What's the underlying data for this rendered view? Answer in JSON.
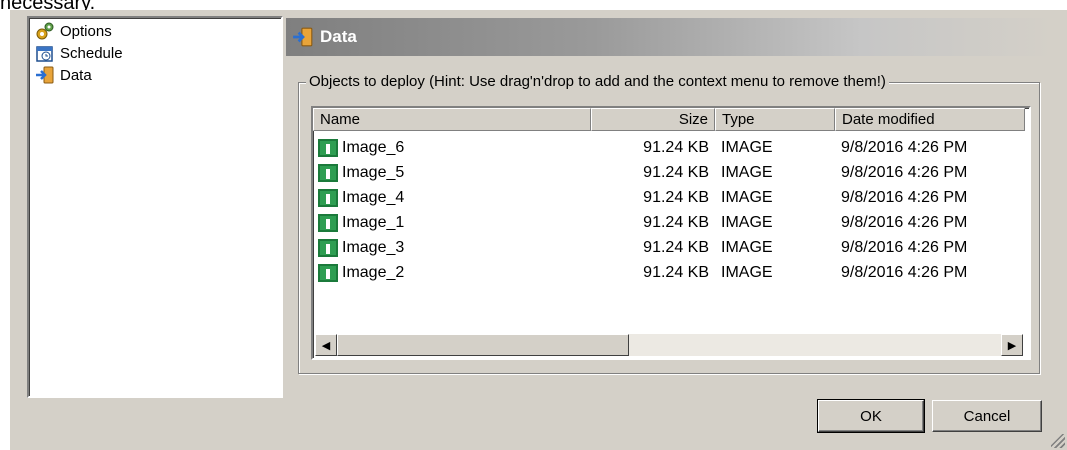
{
  "top_text": "necessary.",
  "tree": {
    "items": [
      {
        "label": "Options",
        "icon": "options-icon"
      },
      {
        "label": "Schedule",
        "icon": "schedule-icon"
      },
      {
        "label": "Data",
        "icon": "data-icon"
      }
    ]
  },
  "header": {
    "title": "Data",
    "icon": "data-icon"
  },
  "group": {
    "legend": "Objects to deploy (Hint: Use drag'n'drop to add and the context menu to remove them!)"
  },
  "list": {
    "columns": [
      "Name",
      "Size",
      "Type",
      "Date modified"
    ],
    "rows": [
      {
        "name": "Image_6",
        "size": "91.24 KB",
        "type": "IMAGE",
        "date": "9/8/2016 4:26 PM"
      },
      {
        "name": "Image_5",
        "size": "91.24 KB",
        "type": "IMAGE",
        "date": "9/8/2016 4:26 PM"
      },
      {
        "name": "Image_4",
        "size": "91.24 KB",
        "type": "IMAGE",
        "date": "9/8/2016 4:26 PM"
      },
      {
        "name": "Image_1",
        "size": "91.24 KB",
        "type": "IMAGE",
        "date": "9/8/2016 4:26 PM"
      },
      {
        "name": "Image_3",
        "size": "91.24 KB",
        "type": "IMAGE",
        "date": "9/8/2016 4:26 PM"
      },
      {
        "name": "Image_2",
        "size": "91.24 KB",
        "type": "IMAGE",
        "date": "9/8/2016 4:26 PM"
      }
    ]
  },
  "buttons": {
    "ok": "OK",
    "cancel": "Cancel"
  },
  "colors": {
    "dialog_bg": "#d4d0c8",
    "header_dark": "#7f7f7f",
    "image_icon": "#1b7a3b"
  }
}
